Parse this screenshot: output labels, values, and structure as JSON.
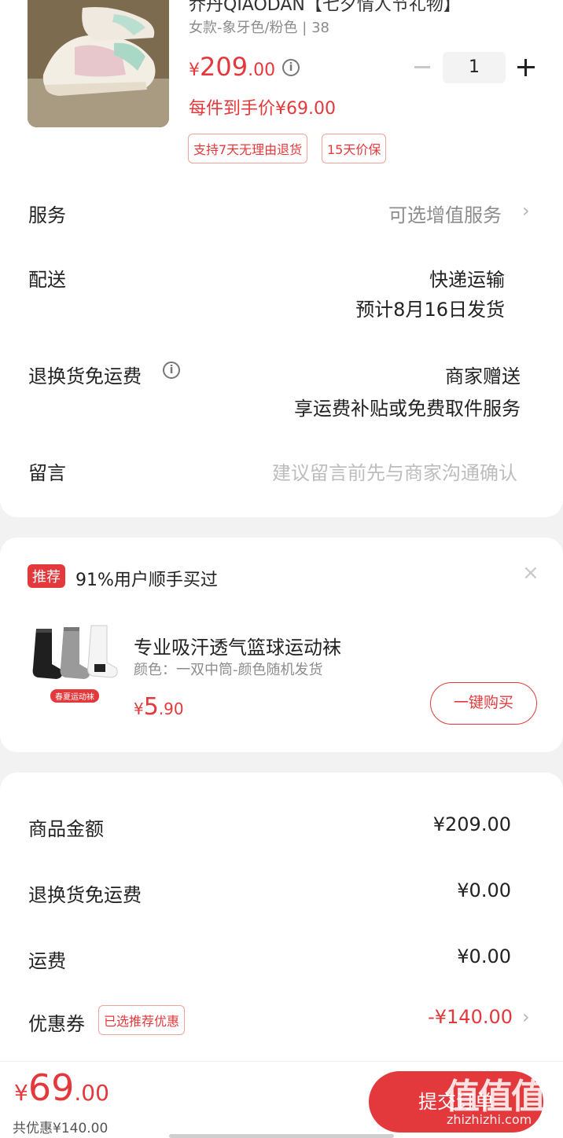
{
  "product": {
    "title_partial": "乔丹QIAODAN【七夕情人节礼物】",
    "variant": "女款-象牙色/粉色 | 38",
    "price_yen": "¥",
    "price_main": "209",
    "price_dec": ".00",
    "quantity": "1",
    "per_item_price": "每件到手价¥69.00",
    "tags": [
      "支持7天无理由退货",
      "15天价保"
    ]
  },
  "options": {
    "service_label": "服务",
    "service_value": "可选增值服务",
    "delivery_label": "配送",
    "delivery_line1": "快递运输",
    "delivery_line2": "预计8月16日发货",
    "return_label": "退换货免运费",
    "return_line1": "商家赠送",
    "return_line2": "享运费补贴或免费取件服务",
    "message_label": "留言",
    "message_placeholder": "建议留言前先与商家沟通确认"
  },
  "recommend": {
    "badge": "推荐",
    "headline": "91%用户顺手买过",
    "item_name": "专业吸汗透气篮球运动袜",
    "item_spec": "颜色：一双中筒-颜色随机发货",
    "price_yen": "¥",
    "price_main": "5",
    "price_dec": ".90",
    "buy_button": "一键购买",
    "image_caption": "春夏运动袜"
  },
  "summary": {
    "goods_label": "商品金额",
    "goods_value": "¥209.00",
    "return_fee_label": "退换货免运费",
    "return_fee_value": "¥0.00",
    "shipping_label": "运费",
    "shipping_value": "¥0.00",
    "coupon_label": "优惠券",
    "coupon_tag": "已选推荐优惠",
    "coupon_value": "-¥140.00"
  },
  "footer": {
    "total_yen": "¥",
    "total_main": "69",
    "total_dec": ".00",
    "total_discount": "共优惠¥140.00",
    "submit_button": "提交订单",
    "watermark_text": "值值值",
    "watermark_url": "zhizhizhi.com"
  },
  "colors": {
    "accent": "#e4393c",
    "background": "#f2f2f2"
  }
}
